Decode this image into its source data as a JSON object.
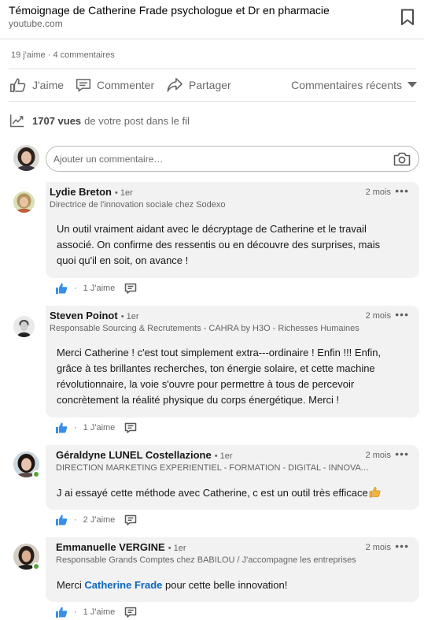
{
  "link": {
    "title": "Témoignage de Catherine Frade psychologue et Dr en pharmacie",
    "domain": "youtube.com"
  },
  "social_counts": "19 j'aime · 4 commentaires",
  "actions": {
    "like": "J'aime",
    "comment": "Commenter",
    "share": "Partager",
    "sort": "Commentaires récents"
  },
  "views": {
    "count": "1707 vues",
    "suffix": "de votre post dans le fil"
  },
  "comment_input": {
    "placeholder": "Ajouter un commentaire…"
  },
  "comments": [
    {
      "author": "Lydie Breton",
      "degree": "• 1er",
      "headline": "Directrice de l'innovation sociale chez Sodexo",
      "time": "2 mois",
      "lines": [
        "Un outil vraiment aidant avec le décryptage de Catherine et le travail",
        "associé. On confirme des ressentis ou en découvre des surprises, mais",
        "quoi qu'il en soit, on avance !"
      ],
      "likes": "1 J'aime"
    },
    {
      "author": "Steven Poinot",
      "degree": "• 1er",
      "headline": "Responsable Sourcing & Recrutements - CAHRA by H3O - Richesses Humaines",
      "time": "2 mois",
      "lines": [
        "Merci Catherine ! c'est tout simplement extra---ordinaire ! Enfin !!! Enfin,",
        "grâce à tes brillantes recherches, ton énergie solaire, et cette machine",
        "révolutionnaire, la voie s'ouvre pour permettre à tous de percevoir",
        "concrètement la réalité physique du corps énergétique. Merci !"
      ],
      "likes": "1 J'aime"
    },
    {
      "author": "Géraldyne LUNEL Costellazione",
      "degree": "• 1er",
      "headline": "DIRECTION MARKETING EXPERIENTIEL - FORMATION - DIGITAL - INNOVATION",
      "time": "2 mois",
      "lines": [
        "J ai essayé cette méthode avec Catherine, c est un outil très efficace"
      ],
      "likes": "2 J'aime"
    },
    {
      "author": "Emmanuelle VERGINE",
      "degree": "• 1er",
      "headline": "Responsable Grands Comptes chez BABILOU / J'accompagne les entreprises",
      "time": "2 mois",
      "text_before": "Merci ",
      "mention": "Catherine Frade",
      "text_after": " pour cette belle innovation!",
      "likes": "1 J'aime"
    }
  ],
  "colors": {
    "accent": "#0a66c2",
    "like_blue": "#378fe9",
    "bubble_bg": "#f2f2f2",
    "online": "#57a23d"
  },
  "icons": [
    "bookmark-icon",
    "thumbs-up-icon",
    "comment-icon",
    "share-icon",
    "caret-down-icon",
    "trend-icon",
    "camera-icon",
    "more-icon",
    "reply-icon",
    "thumbs-up-emoji"
  ]
}
